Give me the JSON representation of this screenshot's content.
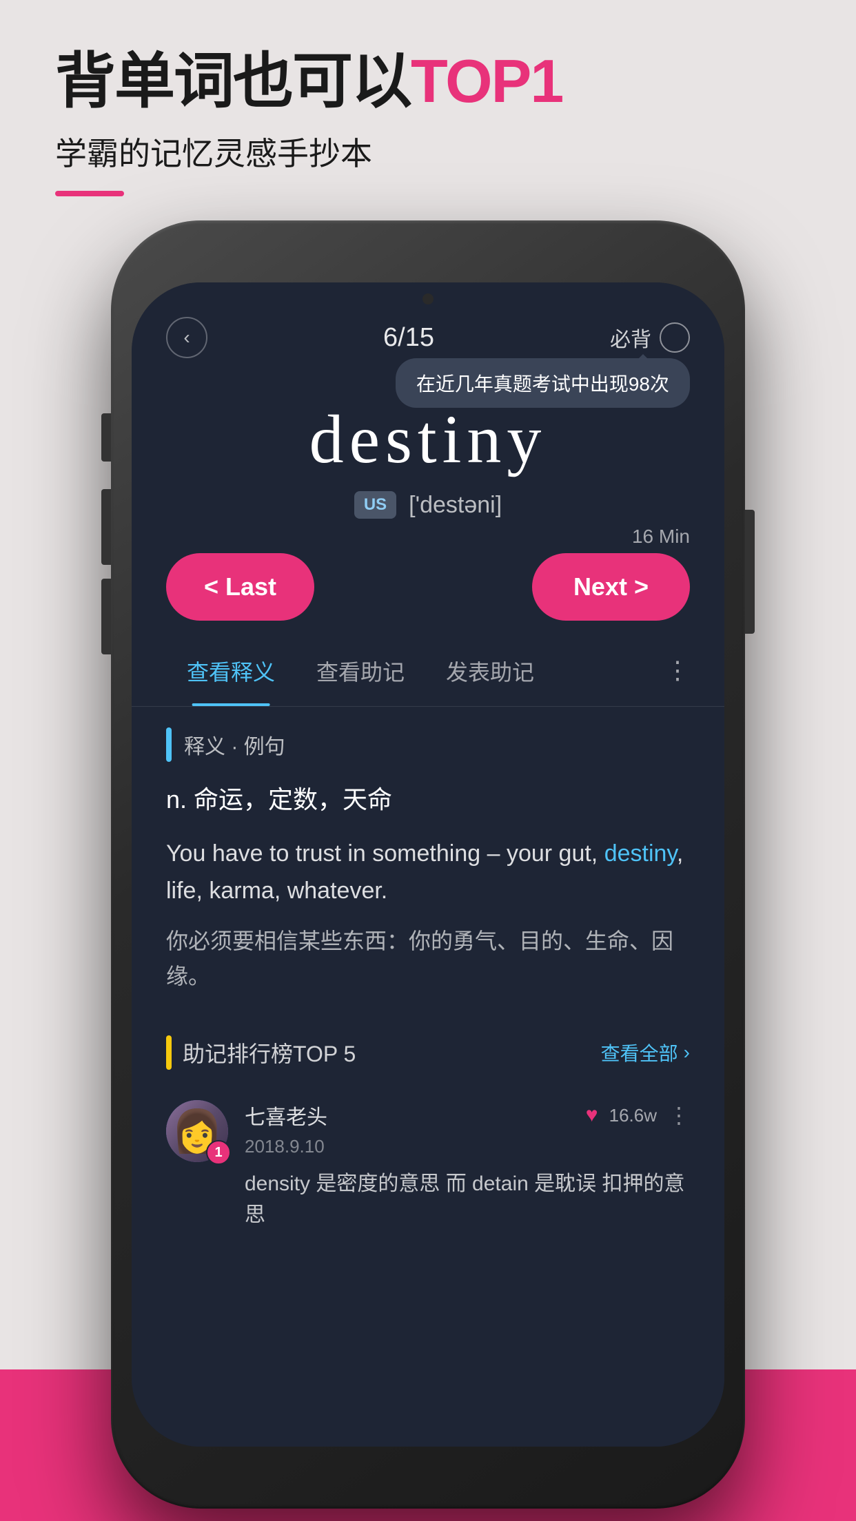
{
  "header": {
    "title_part1": "背单词也可以",
    "title_part2": "TOP1",
    "subtitle": "学霸的记忆灵感手抄本"
  },
  "phone": {
    "top_bar": {
      "back_label": "‹",
      "page_counter": "6/15",
      "must_remember": "必背",
      "tooltip": "在近几年真题考试中出现98次"
    },
    "word": {
      "text": "destiny",
      "phonetic_tag": "US",
      "phonetic": "['destəni]"
    },
    "timer": "16 Min",
    "nav": {
      "last_label": "< Last",
      "next_label": "Next >"
    },
    "tabs": [
      {
        "label": "查看释义",
        "active": true
      },
      {
        "label": "查看助记",
        "active": false
      },
      {
        "label": "发表助记",
        "active": false
      }
    ],
    "section_definition": {
      "label": "释义 · 例句",
      "definition": "n.  命运，定数，天命",
      "example_en_prefix": "You have to trust in something – your gut, ",
      "example_en_word": "destiny",
      "example_en_suffix": ", life, karma, whatever.",
      "example_zh": "你必须要相信某些东西：你的勇气、目的、生命、因缘。"
    },
    "section_mnemonic": {
      "title": "助记排行榜TOP 5",
      "view_all": "查看全部",
      "card": {
        "username": "七喜老头",
        "date": "2018.9.10",
        "rank": "1",
        "likes": "16.6w",
        "text": "density 是密度的意思 而 detain 是耽误 扣押的意思"
      }
    }
  }
}
